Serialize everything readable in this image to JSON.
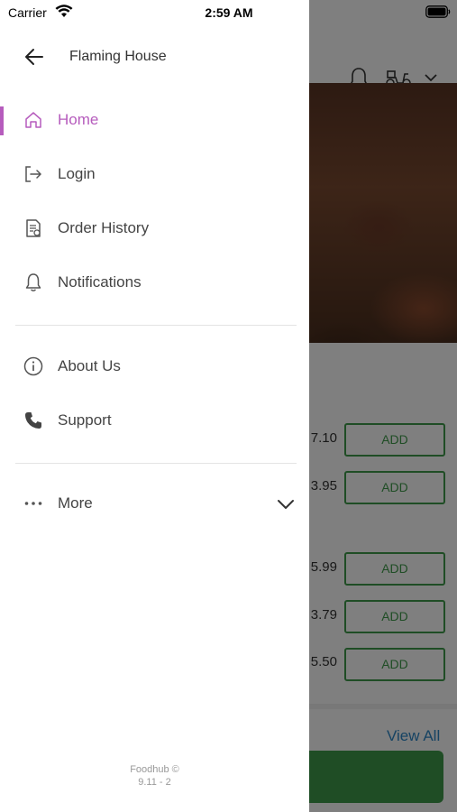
{
  "status_bar": {
    "carrier": "Carrier",
    "time": "2:59 AM"
  },
  "drawer": {
    "title": "Flaming House",
    "items": [
      {
        "label": "Home",
        "icon": "home-icon",
        "active": true
      },
      {
        "label": "Login",
        "icon": "login-icon"
      },
      {
        "label": "Order History",
        "icon": "order-history-icon"
      },
      {
        "label": "Notifications",
        "icon": "bell-icon"
      },
      {
        "label": "About Us",
        "icon": "info-icon"
      },
      {
        "label": "Support",
        "icon": "phone-icon"
      },
      {
        "label": "More",
        "icon": "more-dots-icon"
      }
    ],
    "footer": {
      "brand": "Foodhub ©",
      "version": "9.11 - 2"
    },
    "accent_color": "#b65cbd"
  },
  "background": {
    "prices": [
      "7.10",
      "3.95",
      "5.99",
      "3.79",
      "5.50"
    ],
    "add_label": "ADD",
    "view_all": "View All",
    "accent_green": "#3f9b4a",
    "link_blue": "#2d86c6"
  }
}
